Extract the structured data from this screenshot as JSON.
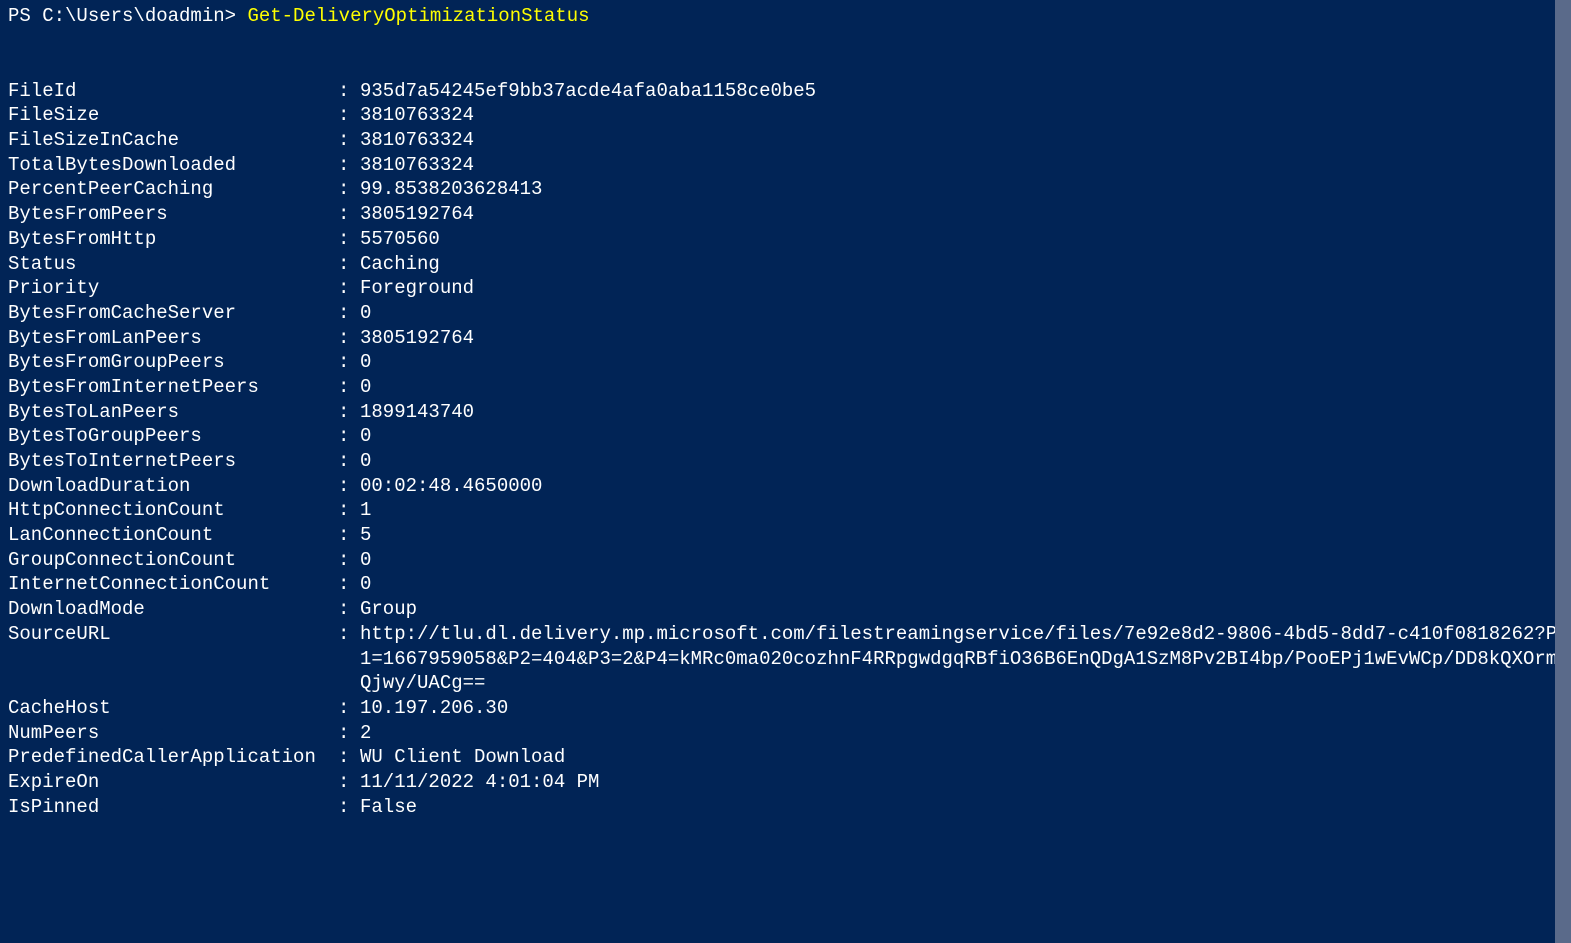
{
  "prompt": "PS C:\\Users\\doadmin> ",
  "command": "Get-DeliveryOptimizationStatus",
  "properties": [
    {
      "name": "FileId",
      "value": "935d7a54245ef9bb37acde4afa0aba1158ce0be5"
    },
    {
      "name": "FileSize",
      "value": "3810763324"
    },
    {
      "name": "FileSizeInCache",
      "value": "3810763324"
    },
    {
      "name": "TotalBytesDownloaded",
      "value": "3810763324"
    },
    {
      "name": "PercentPeerCaching",
      "value": "99.8538203628413"
    },
    {
      "name": "BytesFromPeers",
      "value": "3805192764"
    },
    {
      "name": "BytesFromHttp",
      "value": "5570560"
    },
    {
      "name": "Status",
      "value": "Caching"
    },
    {
      "name": "Priority",
      "value": "Foreground"
    },
    {
      "name": "BytesFromCacheServer",
      "value": "0"
    },
    {
      "name": "BytesFromLanPeers",
      "value": "3805192764"
    },
    {
      "name": "BytesFromGroupPeers",
      "value": "0"
    },
    {
      "name": "BytesFromInternetPeers",
      "value": "0"
    },
    {
      "name": "BytesToLanPeers",
      "value": "1899143740"
    },
    {
      "name": "BytesToGroupPeers",
      "value": "0"
    },
    {
      "name": "BytesToInternetPeers",
      "value": "0"
    },
    {
      "name": "DownloadDuration",
      "value": "00:02:48.4650000"
    },
    {
      "name": "HttpConnectionCount",
      "value": "1"
    },
    {
      "name": "LanConnectionCount",
      "value": "5"
    },
    {
      "name": "GroupConnectionCount",
      "value": "0"
    },
    {
      "name": "InternetConnectionCount",
      "value": "0"
    },
    {
      "name": "DownloadMode",
      "value": "Group"
    },
    {
      "name": "SourceURL",
      "value": "http://tlu.dl.delivery.mp.microsoft.com/filestreamingservice/files/7e92e8d2-9806-4bd5-8dd7-c410f0818262?P1=1667959058&P2=404&P3=2&P4=kMRc0ma020cozhnF4RRpgwdgqRBfiO36B6EnQDgA1SzM8Pv2BI4bp/PooEPj1wEvWCp/DD8kQXOrmQjwy/UACg==",
      "multiline": true
    },
    {
      "name": "CacheHost",
      "value": "10.197.206.30"
    },
    {
      "name": "NumPeers",
      "value": "2"
    },
    {
      "name": "PredefinedCallerApplication",
      "value": "WU Client Download"
    },
    {
      "name": "ExpireOn",
      "value": "11/11/2022 4:01:04 PM"
    },
    {
      "name": "IsPinned",
      "value": "False"
    }
  ]
}
